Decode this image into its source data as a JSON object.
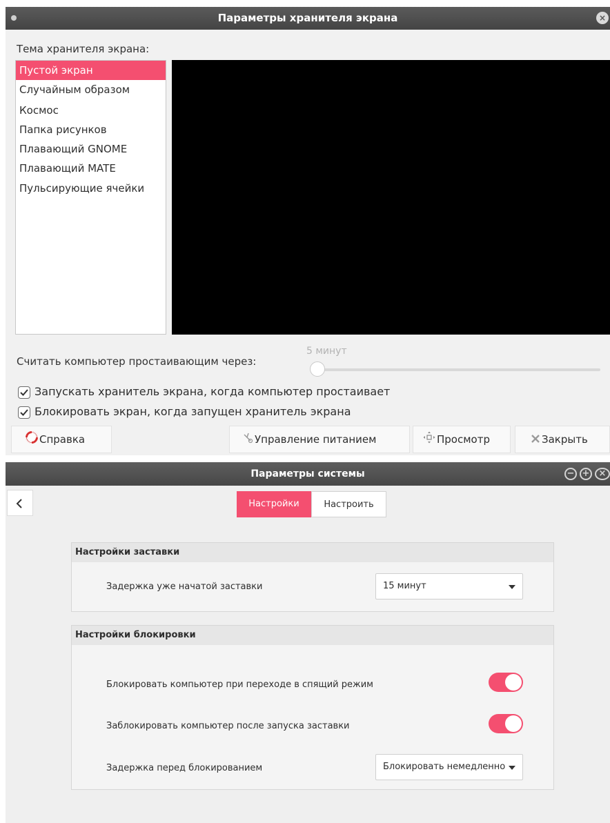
{
  "screensaver": {
    "title": "Параметры хранителя экрана",
    "theme_label": "Тема хранителя экрана:",
    "themes": [
      {
        "label": "Пустой экран",
        "selected": true
      },
      {
        "label": "Случайным образом",
        "selected": false
      },
      {
        "label": "Космос",
        "selected": false
      },
      {
        "label": "Папка рисунков",
        "selected": false
      },
      {
        "label": "Плавающий GNOME",
        "selected": false
      },
      {
        "label": "Плавающий MATE",
        "selected": false
      },
      {
        "label": "Пульсирующие ячейки",
        "selected": false
      }
    ],
    "idle_label": "Считать компьютер простаивающим через:",
    "idle_value": "5 минут",
    "idle_fraction": 0.01,
    "activate_label": "Запускать хранитель экрана, когда компьютер простаивает",
    "activate_checked": true,
    "lock_label": "Блокировать экран, когда запущен хранитель экрана",
    "lock_checked": true,
    "buttons": {
      "help": "Справка",
      "power": "Управление питанием",
      "preview": "Просмотр",
      "close": "Закрыть"
    }
  },
  "system": {
    "title": "Параметры системы",
    "tabs": {
      "active": "Настройки",
      "inactive": "Настроить"
    },
    "saver_group": {
      "header": "Настройки заставки",
      "delay_label": "Задержка уже начатой заставки",
      "delay_value": "15 минут"
    },
    "lock_group": {
      "header": "Настройки блокировки",
      "sleep_label": "Блокировать компьютер при переходе в спящий режим",
      "sleep_on": true,
      "saver_lock_label": "Заблокировать компьютер после запуска заставки",
      "saver_lock_on": true,
      "lock_delay_label": "Задержка перед блокированием",
      "lock_delay_value": "Блокировать немедленно"
    }
  },
  "colors": {
    "accent": "#f44f70",
    "titlebar": "#4d4d4d",
    "preview_bg": "#000000"
  }
}
